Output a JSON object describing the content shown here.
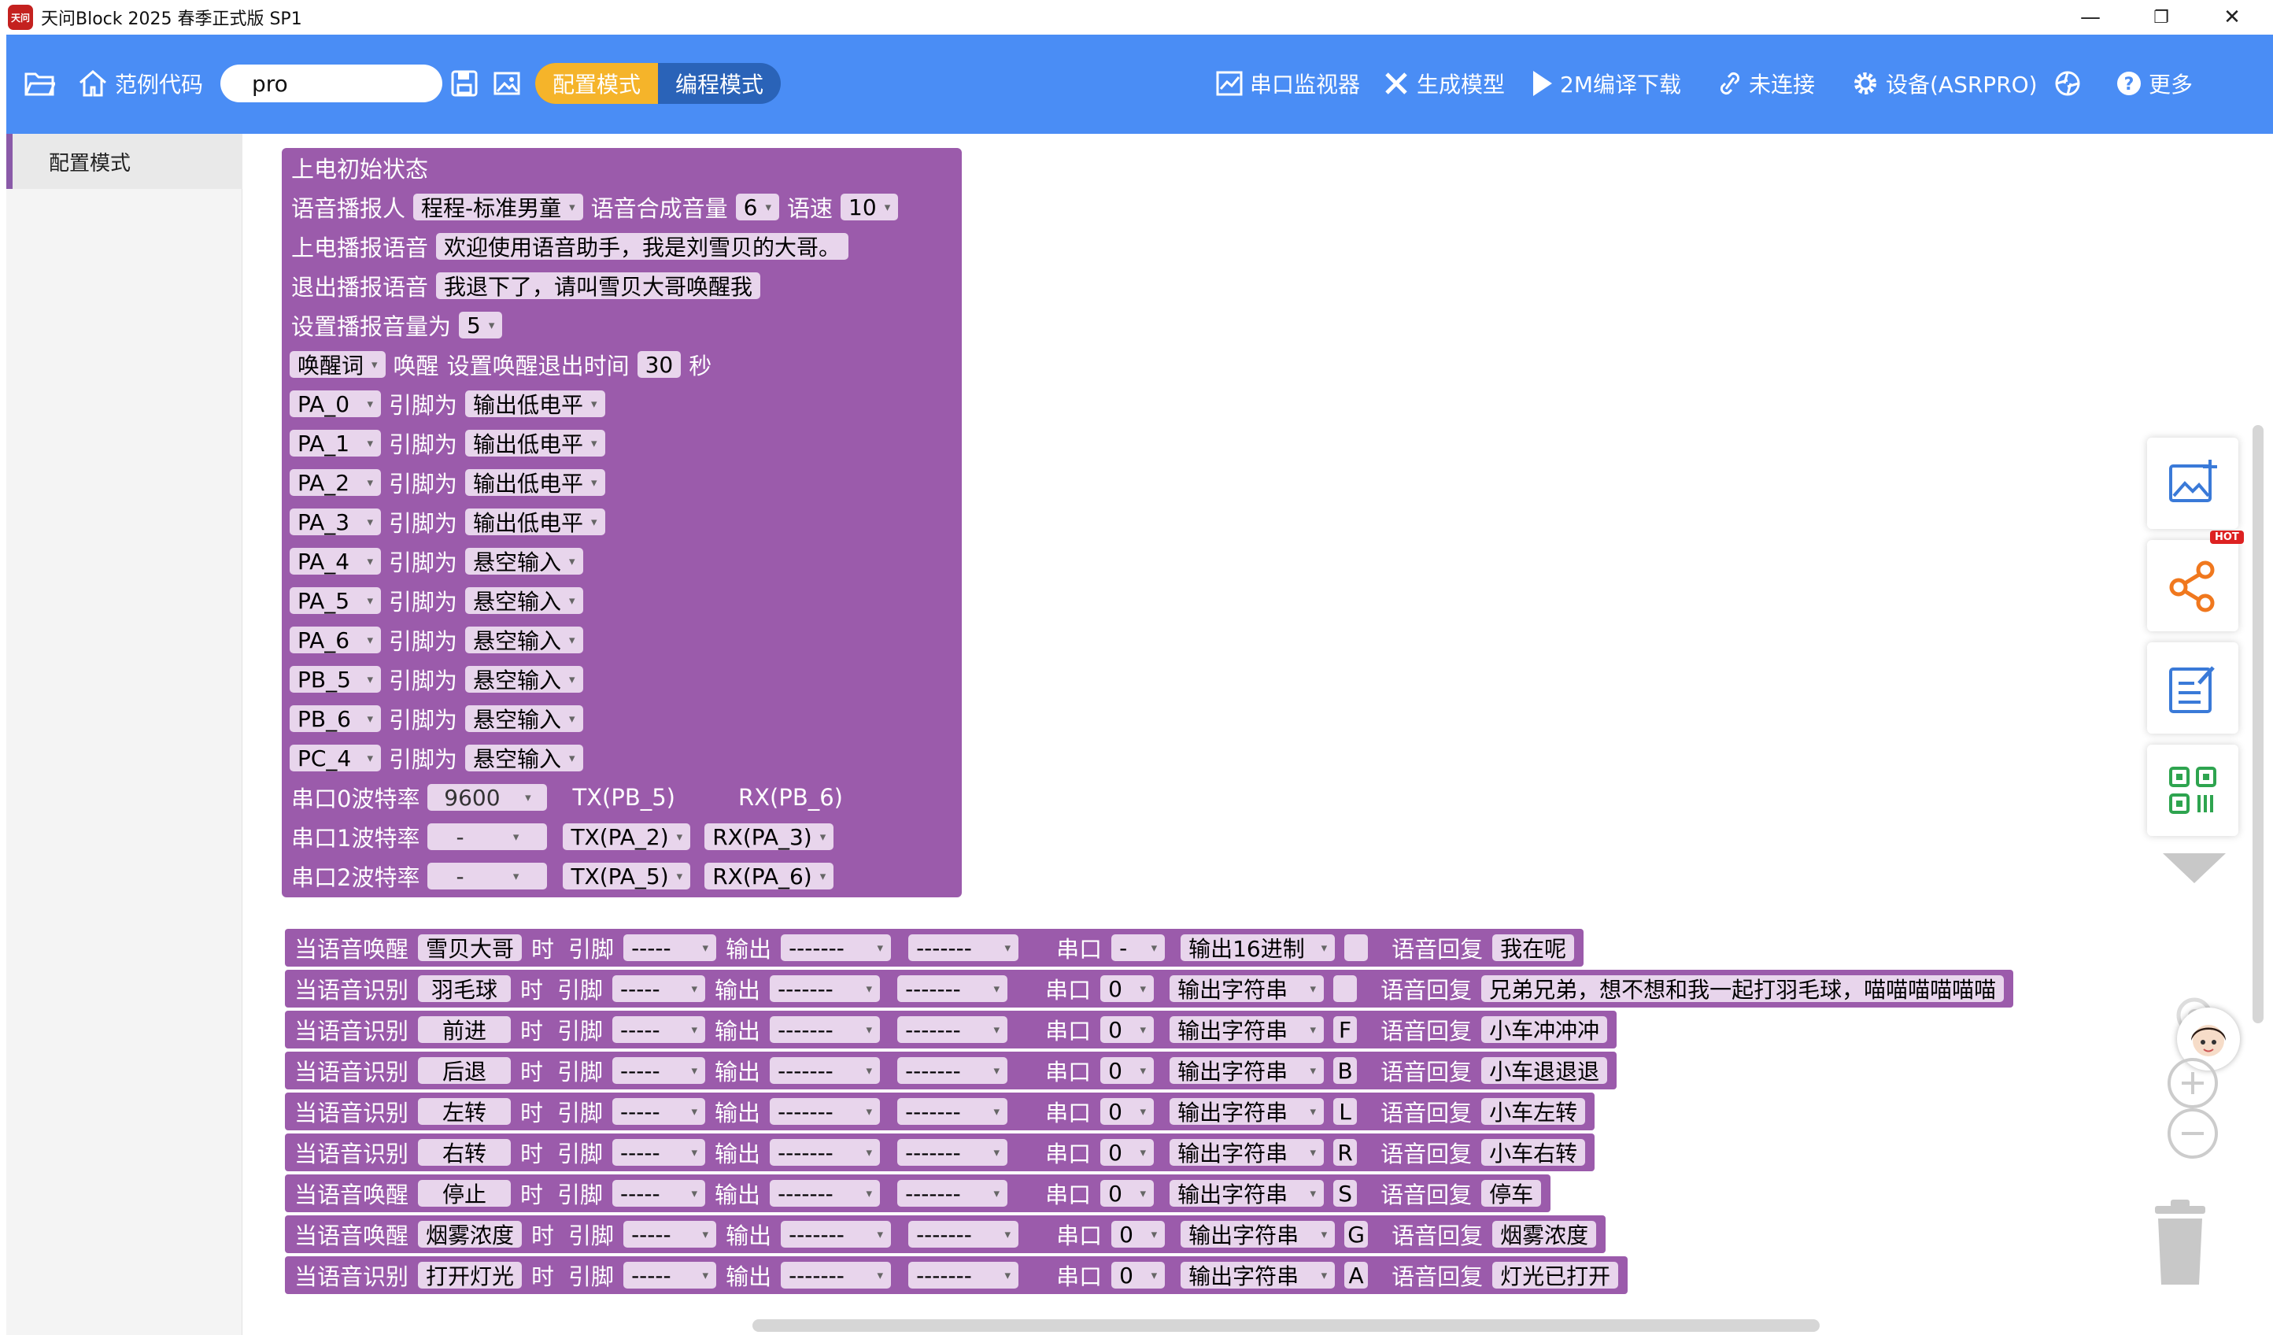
{
  "app": {
    "title": "天问Block 2025 春季正式版 SP1",
    "logo_text": "天问"
  },
  "window": {
    "minimize": "—",
    "restore": "❐",
    "close": "✕"
  },
  "toolbar": {
    "examples_label": "范例代码",
    "search_value": "pro",
    "mode_config": "配置模式",
    "mode_program": "编程模式",
    "serial_monitor": "串口监视器",
    "generate_model": "生成模型",
    "compile_download": "2M编译下载",
    "not_connected": "未连接",
    "device": "设备(ASRPRO)",
    "more": "更多"
  },
  "sidebar": {
    "items": [
      {
        "label": "配置模式"
      }
    ]
  },
  "power_block": {
    "title": "上电初始状态",
    "speaker_label": "语音播报人",
    "speaker_value": "程程-标准男童",
    "volume_label": "语音合成音量",
    "volume_value": "6",
    "speed_label": "语速",
    "speed_value": "10",
    "boot_label": "上电播报语音",
    "boot_value": "欢迎使用语音助手，我是刘雪贝的大哥。",
    "exit_label": "退出播报语音",
    "exit_value": "我退下了，请叫雪贝大哥唤醒我",
    "setvol_label": "设置播报音量为",
    "setvol_value": "5",
    "wake_value": "唤醒词",
    "wake_text": "唤醒",
    "wake_timeout_label": "设置唤醒退出时间",
    "wake_timeout_value": "30",
    "wake_unit": "秒",
    "pin_label": "引脚为",
    "pins": [
      {
        "pin": "PA_0",
        "mode": "输出低电平"
      },
      {
        "pin": "PA_1",
        "mode": "输出低电平"
      },
      {
        "pin": "PA_2",
        "mode": "输出低电平"
      },
      {
        "pin": "PA_3",
        "mode": "输出低电平"
      },
      {
        "pin": "PA_4",
        "mode": "悬空输入"
      },
      {
        "pin": "PA_5",
        "mode": "悬空输入"
      },
      {
        "pin": "PA_6",
        "mode": "悬空输入"
      },
      {
        "pin": "PB_5",
        "mode": "悬空输入"
      },
      {
        "pin": "PB_6",
        "mode": "悬空输入"
      },
      {
        "pin": "PC_4",
        "mode": "悬空输入"
      }
    ],
    "uarts": [
      {
        "label": "串口0波特率",
        "baud": "9600",
        "tx": "TX(PB_5)",
        "rx": "RX(PB_6)"
      },
      {
        "label": "串口1波特率",
        "baud": "-",
        "tx": "TX(PA_2)",
        "rx": "RX(PA_3)"
      },
      {
        "label": "串口2波特率",
        "baud": "-",
        "tx": "TX(PA_5)",
        "rx": "RX(PA_6)"
      }
    ]
  },
  "cmd_labels": {
    "when_label_time": "时",
    "pin": "引脚",
    "output": "输出",
    "serial": "串口",
    "reply": "语音回复",
    "pin_value": "-----",
    "out_value1": "-------",
    "out_value2": "-------"
  },
  "commands": [
    {
      "trigger": "当语音唤醒",
      "word": "雪贝大哥",
      "serial": "-",
      "format": "输出16进制",
      "char": "",
      "reply": "我在呢"
    },
    {
      "trigger": "当语音识别",
      "word": "羽毛球",
      "serial": "0",
      "format": "输出字符串",
      "char": "",
      "reply": "兄弟兄弟，想不想和我一起打羽毛球，喵喵喵喵喵喵"
    },
    {
      "trigger": "当语音识别",
      "word": "前进",
      "serial": "0",
      "format": "输出字符串",
      "char": "F",
      "reply": "小车冲冲冲"
    },
    {
      "trigger": "当语音识别",
      "word": "后退",
      "serial": "0",
      "format": "输出字符串",
      "char": "B",
      "reply": "小车退退退"
    },
    {
      "trigger": "当语音识别",
      "word": "左转",
      "serial": "0",
      "format": "输出字符串",
      "char": "L",
      "reply": "小车左转"
    },
    {
      "trigger": "当语音识别",
      "word": "右转",
      "serial": "0",
      "format": "输出字符串",
      "char": "R",
      "reply": "小车右转"
    },
    {
      "trigger": "当语音唤醒",
      "word": "停止",
      "serial": "0",
      "format": "输出字符串",
      "char": "S",
      "reply": "停车"
    },
    {
      "trigger": "当语音唤醒",
      "word": "烟雾浓度",
      "serial": "0",
      "format": "输出字符串",
      "char": "G",
      "reply": "烟雾浓度"
    },
    {
      "trigger": "当语音识别",
      "word": "打开灯光",
      "serial": "0",
      "format": "输出字符串",
      "char": "A",
      "reply": "灯光已打开"
    }
  ],
  "right_panel": {
    "hot_badge": "HOT"
  },
  "colors": {
    "toolbar": "#4a8df5",
    "block": "#9b5bab",
    "field": "#e8d5ec",
    "accent": "#f5b42a"
  }
}
